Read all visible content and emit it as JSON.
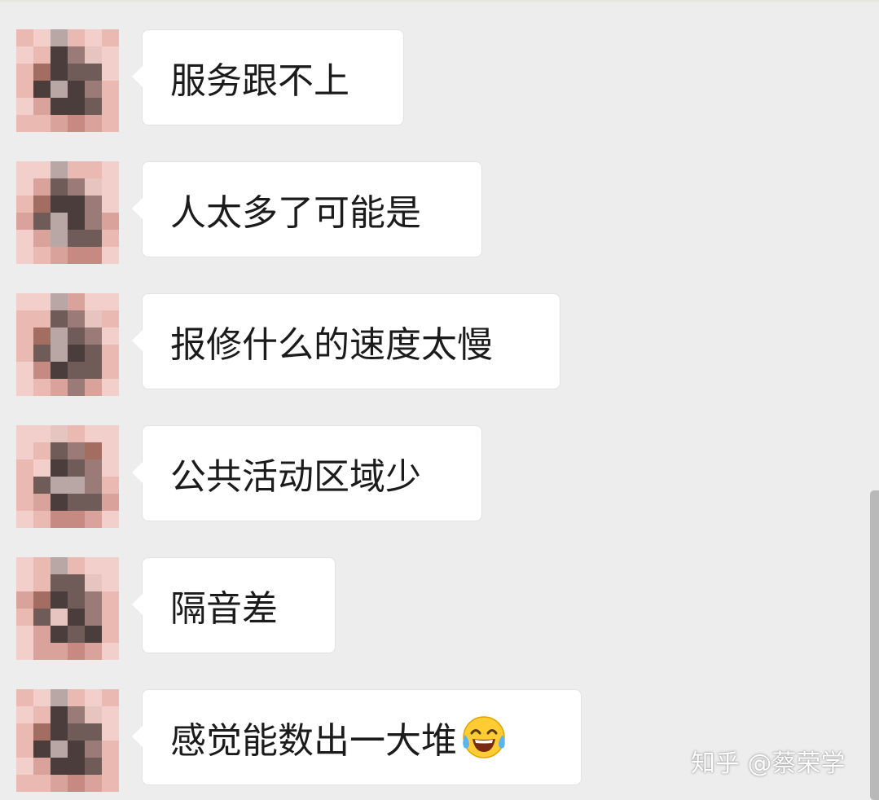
{
  "messages": [
    {
      "text": "服务跟不上"
    },
    {
      "text": "人太多了可能是"
    },
    {
      "text": "报修什么的速度太慢"
    },
    {
      "text": "公共活动区域少"
    },
    {
      "text": "隔音差"
    },
    {
      "text": "感觉能数出一大堆",
      "emoji": "tears-of-joy-emoji"
    }
  ],
  "watermark": "知乎 @蔡荣学",
  "colors": {
    "background": "#ededed",
    "bubble": "#ffffff",
    "text": "#1b1b1b",
    "avatar_tint": "#f0c9c4"
  }
}
